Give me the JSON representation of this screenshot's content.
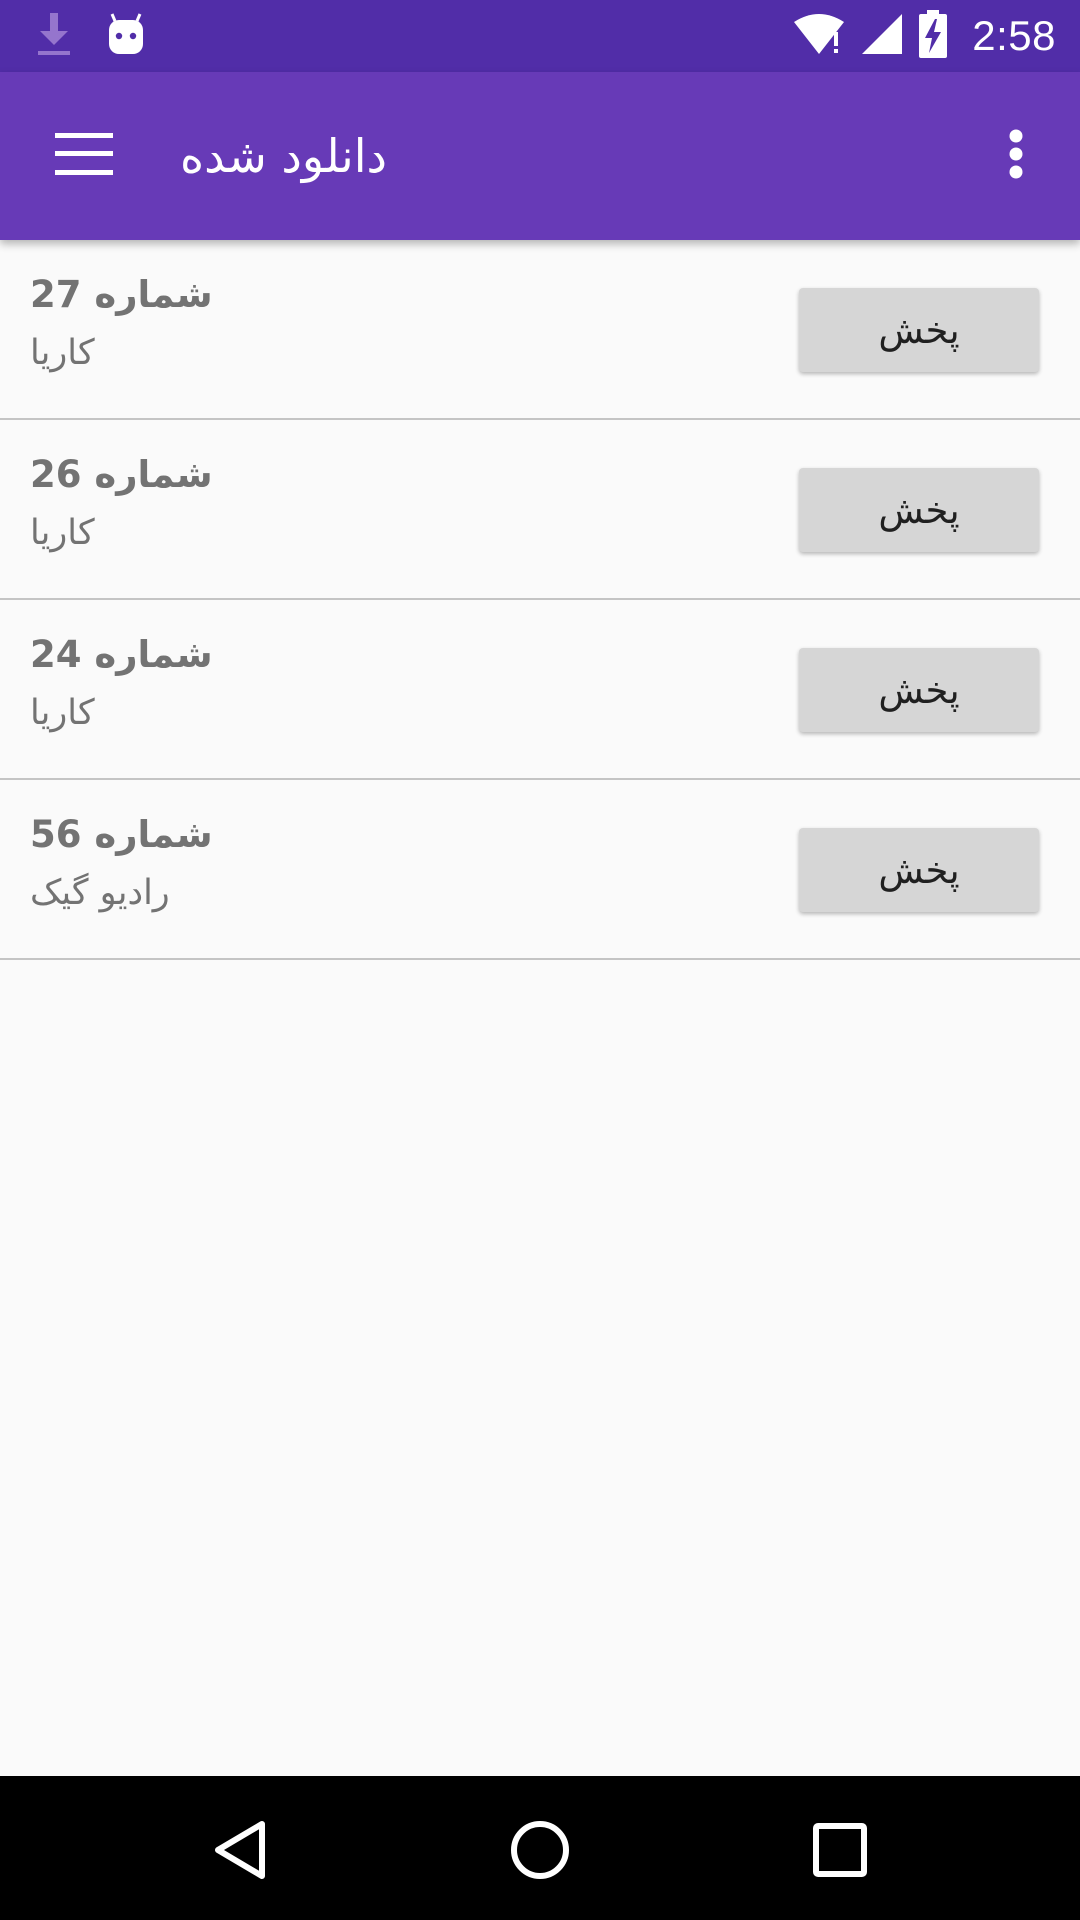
{
  "status_bar": {
    "time": "2:58",
    "icons": [
      "download-icon",
      "android-icon",
      "wifi-icon",
      "signal-icon",
      "battery-charging-icon"
    ]
  },
  "app_bar": {
    "title": "دانلود شده",
    "menu_icon": "hamburger-menu-icon",
    "overflow_icon": "more-vert-icon"
  },
  "items": [
    {
      "title": "شماره 27",
      "subtitle": "کاریا",
      "button": "پخش"
    },
    {
      "title": "شماره 26",
      "subtitle": "کاریا",
      "button": "پخش"
    },
    {
      "title": "شماره 24",
      "subtitle": "کاریا",
      "button": "پخش"
    },
    {
      "title": "شماره 56",
      "subtitle": "رادیو گیک",
      "button": "پخش"
    }
  ],
  "nav_bar": {
    "icons": [
      "back-icon",
      "home-icon",
      "recents-icon"
    ]
  },
  "colors": {
    "status_bar": "#512da8",
    "app_bar": "#673ab7",
    "background": "#fafafa",
    "button": "#d6d6d6",
    "divider": "#c4c4c4",
    "nav_bar": "#000000"
  }
}
